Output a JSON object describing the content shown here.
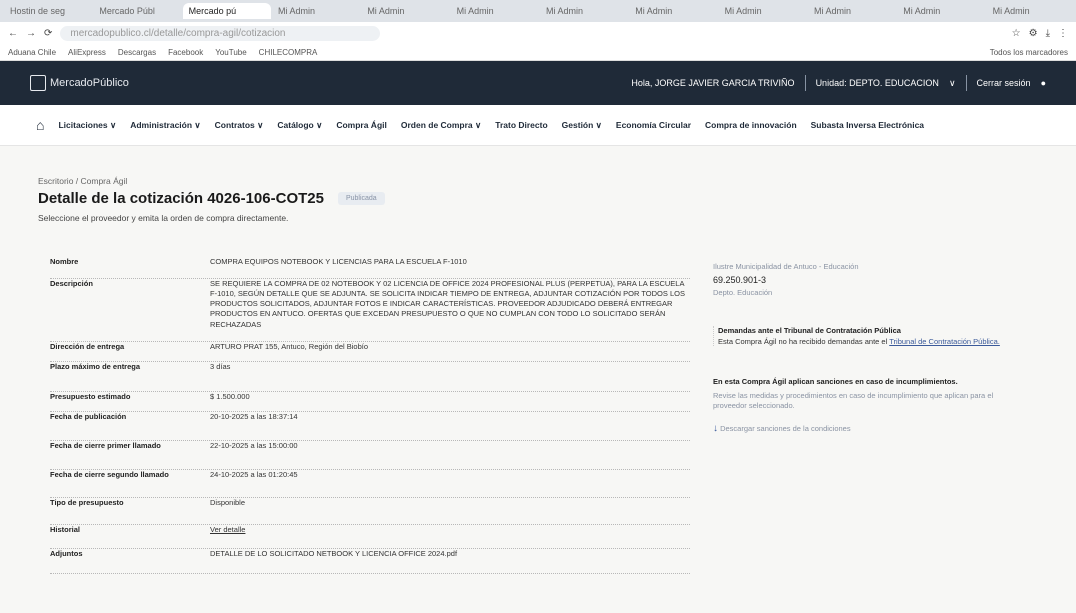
{
  "browser": {
    "tabs": [
      "Hostin de seg",
      "Mercado Públ",
      "Mercado pú",
      "Mi Admin",
      "Mi Admin",
      "Mi Admin",
      "Mi Admin",
      "Mi Admin",
      "Mi Admin",
      "Mi Admin",
      "Mi Admin",
      "Mi Admin"
    ],
    "active_tab_index": 2,
    "url": "mercadopublico.cl/detalle/compra-agil/cotizacion",
    "bookmarks": [
      "Aduana Chile",
      "AliExpress",
      "Descargas",
      "Facebook",
      "YouTube",
      "CHILECOMPRA"
    ],
    "bookmarks_right": "Todos los marcadores"
  },
  "header": {
    "logo": "MercadoPúblico",
    "greeting": "Hola, JORGE JAVIER GARCIA TRIVIÑO",
    "unit": "Unidad: DEPTO. EDUCACION",
    "logout": "Cerrar sesión"
  },
  "nav": [
    "Licitaciones ∨",
    "Administración ∨",
    "Contratos ∨",
    "Catálogo ∨",
    "Compra Ágil",
    "Orden de Compra ∨",
    "Trato Directo",
    "Gestión ∨",
    "Economía Circular",
    "Compra de innovación",
    "Subasta Inversa Electrónica"
  ],
  "page": {
    "breadcrumb": "Escritorio / Compra Ágil",
    "title": "Detalle de la cotización 4026-106-COT25",
    "status": "Publicada",
    "subtitle": "Seleccione el proveedor y emita la orden de compra directamente."
  },
  "details": [
    {
      "label": "Nombre",
      "value": "COMPRA EQUIPOS NOTEBOOK Y LICENCIAS PARA LA ESCUELA F-1010"
    },
    {
      "label": "Descripción",
      "value": "SE REQUIERE LA COMPRA DE 02 NOTEBOOK Y 02 LICENCIA DE OFFICE 2024 PROFESIONAL PLUS (PERPETUA), PARA LA ESCUELA F-1010, SEGÚN DETALLE QUE SE ADJUNTA. SE SOLICITA INDICAR TIEMPO DE ENTREGA, ADJUNTAR COTIZACIÓN POR TODOS LOS PRODUCTOS SOLICITADOS, ADJUNTAR FOTOS E INDICAR CARACTERÍSTICAS. PROVEEDOR ADJUDICADO DEBERÁ ENTREGAR PRODUCTOS EN ANTUCO. OFERTAS QUE EXCEDAN PRESUPUESTO O QUE NO CUMPLAN CON TODO LO SOLICITADO SERÁN RECHAZADAS"
    },
    {
      "label": "Dirección de entrega",
      "value": "ARTURO PRAT 155, Antuco, Región del Biobío"
    },
    {
      "label": "Plazo máximo de entrega",
      "value": "3 días"
    },
    {
      "label": "Presupuesto estimado",
      "value": "$ 1.500.000"
    },
    {
      "label": "Fecha de publicación",
      "value": "20-10-2025 a las 18:37:14"
    },
    {
      "label": "Fecha de cierre primer llamado",
      "value": "22-10-2025 a las 15:00:00"
    },
    {
      "label": "Fecha de cierre segundo llamado",
      "value": "24-10-2025 a las 01:20:45"
    },
    {
      "label": "Tipo de presupuesto",
      "value": "Disponible"
    },
    {
      "label": "Historial",
      "value": "Ver detalle"
    },
    {
      "label": "Adjuntos",
      "value": "DETALLE DE LO SOLICITADO NETBOOK Y LICENCIA OFFICE 2024.pdf"
    }
  ],
  "sidebar": {
    "org": "Ilustre Municipalidad de Antuco - Educación",
    "rut": "69.250.901-3",
    "unit": "Depto. Educación",
    "tribunal_title": "Demandas ante el Tribunal de Contratación Pública",
    "tribunal_text": "Esta Compra Ágil no ha recibido demandas ante el",
    "tribunal_link": "Tribunal de Contratación Pública.",
    "sanctions_title": "En esta Compra Ágil aplican sanciones en caso de incumplimientos.",
    "sanctions_text": "Revise las medidas y procedimientos en caso de incumplimiento que aplican para el proveedor seleccionado.",
    "download": "Descargar sanciones de la condiciones"
  }
}
